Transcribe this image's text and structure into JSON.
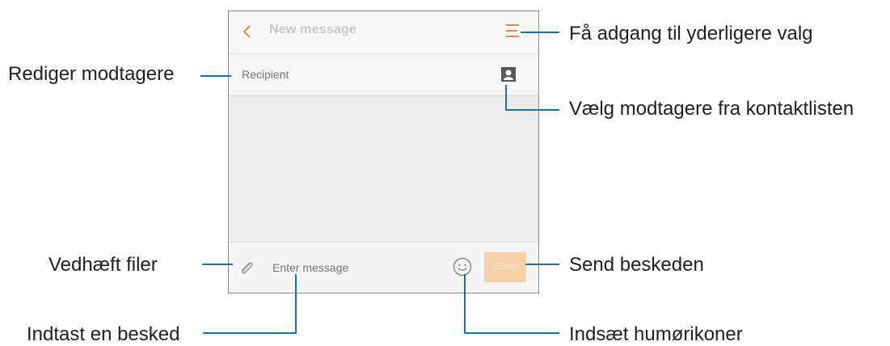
{
  "app": {
    "title": "New message",
    "back_icon": "chevron-left-icon",
    "menu_icon": "menu-icon"
  },
  "recipient": {
    "placeholder": "Recipient",
    "contact_icon": "contact-icon"
  },
  "composer": {
    "attach_icon": "paperclip-icon",
    "placeholder": "Enter message",
    "emoji_icon": "emoji-icon",
    "send_label": "SEND"
  },
  "callouts": {
    "menu": "Få adgang til yderligere valg",
    "recipient": "Rediger modtagere",
    "contacts": "Vælg modtagere fra kontaktlisten",
    "attach": "Vedhæft filer",
    "send": "Send beskeden",
    "message": "Indtast en besked",
    "emoji": "Indsæt humørikoner"
  },
  "colors": {
    "accent": "#f0893c",
    "send_bg": "#f7d0a7",
    "callout_line": "#1473b8"
  }
}
